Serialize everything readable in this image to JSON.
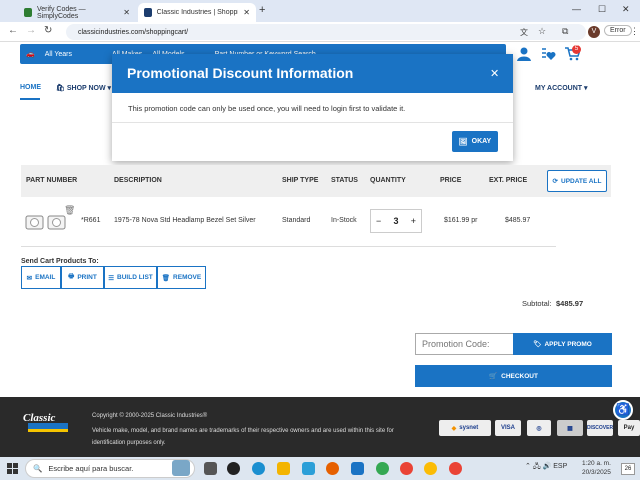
{
  "browser": {
    "tabs": [
      {
        "title": "Verify Codes — SimplyCodes",
        "favicon_color": "#2e7d32"
      },
      {
        "title": "Classic Industries | Shopping C",
        "favicon_color": "#1c3d6e"
      }
    ],
    "url": "classicindustries.com/shoppingcart/",
    "profile_initial": "V",
    "error_label": "Error"
  },
  "site": {
    "vehicle_bar": {
      "year_label": "All Years",
      "make_label": "All Makes",
      "model_label": "All Models",
      "search_placeholder": "Part Number or Keyword Search"
    },
    "cart_count": "5",
    "nav": {
      "home": "HOME",
      "shop_now": "SHOP NOW",
      "my_account": "MY ACCOUNT"
    }
  },
  "modal": {
    "title": "Promotional Discount Information",
    "body": "This promotion code can only be used once, you will need to login first to validate it.",
    "okay_label": "OKAY"
  },
  "cart": {
    "headers": {
      "part_number": "PART NUMBER",
      "description": "DESCRIPTION",
      "ship_type": "SHIP TYPE",
      "status": "STATUS",
      "quantity": "QUANTITY",
      "price": "PRICE",
      "ext_price": "EXT. PRICE"
    },
    "update_all_label": "UPDATE ALL",
    "item": {
      "part_number": "*R661",
      "description": "1975-78 Nova Std Headlamp Bezel Set Silver",
      "ship_type": "Standard",
      "status": "In-Stock",
      "quantity": "3",
      "price": "$161.99 pr",
      "ext_price": "$485.97"
    },
    "send_label": "Send Cart Products To:",
    "send_buttons": {
      "email": "EMAIL",
      "print": "PRINT",
      "build_list": "BUILD LIST",
      "remove": "REMOVE"
    },
    "subtotal_label": "Subtotal:",
    "subtotal_value": "$485.97",
    "promo_placeholder": "Promotion Code:",
    "apply_promo_label": "APPLY PROMO",
    "checkout_label": "CHECKOUT"
  },
  "footer": {
    "logo_text": "Classic",
    "copyright": "Copyright © 2000-2025 Classic Industries®",
    "disclaimer": "Vehicle make, model, and brand names are trademarks of their respective owners and are used within this site for identification purposes only.",
    "payments": [
      "sysnet",
      "VISA",
      "",
      "",
      "DISCOVER",
      "Pay"
    ]
  },
  "taskbar": {
    "search_placeholder": "Escribe aquí para buscar.",
    "language": "ESP",
    "time": "1:20 a. m.",
    "date": "20/3/2025",
    "notification_count": "26"
  },
  "colors": {
    "brand_blue": "#1a73c4",
    "footer_bg": "#2a2a2a"
  }
}
